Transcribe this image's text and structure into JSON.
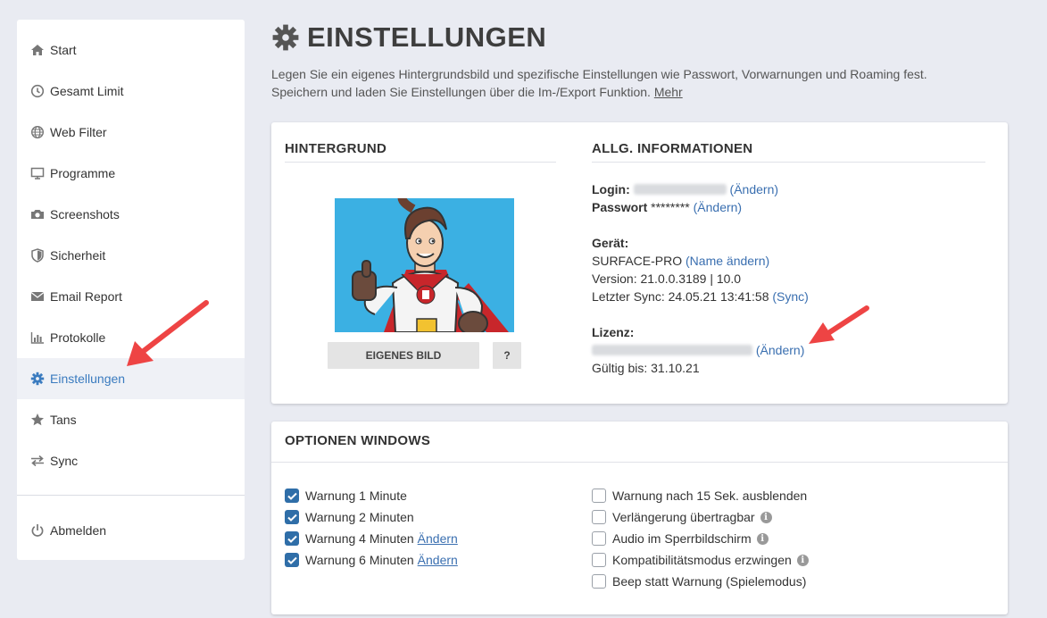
{
  "sidebar": {
    "items": [
      {
        "label": "Start",
        "icon": "home-icon"
      },
      {
        "label": "Gesamt Limit",
        "icon": "clock-icon"
      },
      {
        "label": "Web Filter",
        "icon": "globe-icon"
      },
      {
        "label": "Programme",
        "icon": "monitor-icon"
      },
      {
        "label": "Screenshots",
        "icon": "camera-icon"
      },
      {
        "label": "Sicherheit",
        "icon": "shield-icon"
      },
      {
        "label": "Email Report",
        "icon": "envelope-icon"
      },
      {
        "label": "Protokolle",
        "icon": "bar-chart-icon"
      },
      {
        "label": "Einstellungen",
        "icon": "gear-icon",
        "active": true
      },
      {
        "label": "Tans",
        "icon": "star-icon"
      },
      {
        "label": "Sync",
        "icon": "exchange-icon"
      }
    ],
    "logout": {
      "label": "Abmelden",
      "icon": "power-icon"
    }
  },
  "header": {
    "title": "EINSTELLUNGEN",
    "intro": "Legen Sie ein eigenes Hintergrundsbild und spezifische Einstellungen wie Passwort, Vorwarnungen und Roaming fest. Speichern und laden Sie Einstellungen über die Im-/Export Funktion.",
    "more_link": "Mehr"
  },
  "background": {
    "title": "HINTERGRUND",
    "image_button": "EIGENES BILD",
    "help_button": "?"
  },
  "general": {
    "title": "ALLG. INFORMATIONEN",
    "login_label": "Login:",
    "login_change": "(Ändern)",
    "password_label": "Passwort",
    "password_value": "********",
    "password_change": "(Ändern)",
    "device_label": "Gerät:",
    "device_name": "SURFACE-PRO",
    "device_rename": "(Name ändern)",
    "version": "Version: 21.0.0.3189 | 10.0",
    "last_sync": "Letzter Sync: 24.05.21 13:41:58",
    "sync_link": "(Sync)",
    "license_label": "Lizenz:",
    "license_change": "(Ändern)",
    "valid_until": "Gültig bis: 31.10.21"
  },
  "options": {
    "title": "OPTIONEN WINDOWS",
    "left": [
      {
        "label": "Warnung 1 Minute",
        "checked": true
      },
      {
        "label": "Warnung 2 Minuten",
        "checked": true
      },
      {
        "label": "Warnung 4 Minuten",
        "checked": true,
        "link": "Ändern"
      },
      {
        "label": "Warnung 6 Minuten",
        "checked": true,
        "link": "Ändern"
      }
    ],
    "right": [
      {
        "label": "Warnung nach 15 Sek. ausblenden",
        "checked": false
      },
      {
        "label": "Verlängerung übertragbar",
        "checked": false,
        "info": "i"
      },
      {
        "label": "Audio im Sperrbildschirm",
        "checked": false,
        "info": "i"
      },
      {
        "label": "Kompatibilitätsmodus erzwingen",
        "checked": false,
        "info": "i"
      },
      {
        "label": "Beep statt Warnung (Spielemodus)",
        "checked": false
      }
    ]
  },
  "colors": {
    "accent": "#3a7bbf",
    "checkbox": "#2f6ea8",
    "arrow": "#ee4444",
    "background": "#e9ebf2"
  }
}
